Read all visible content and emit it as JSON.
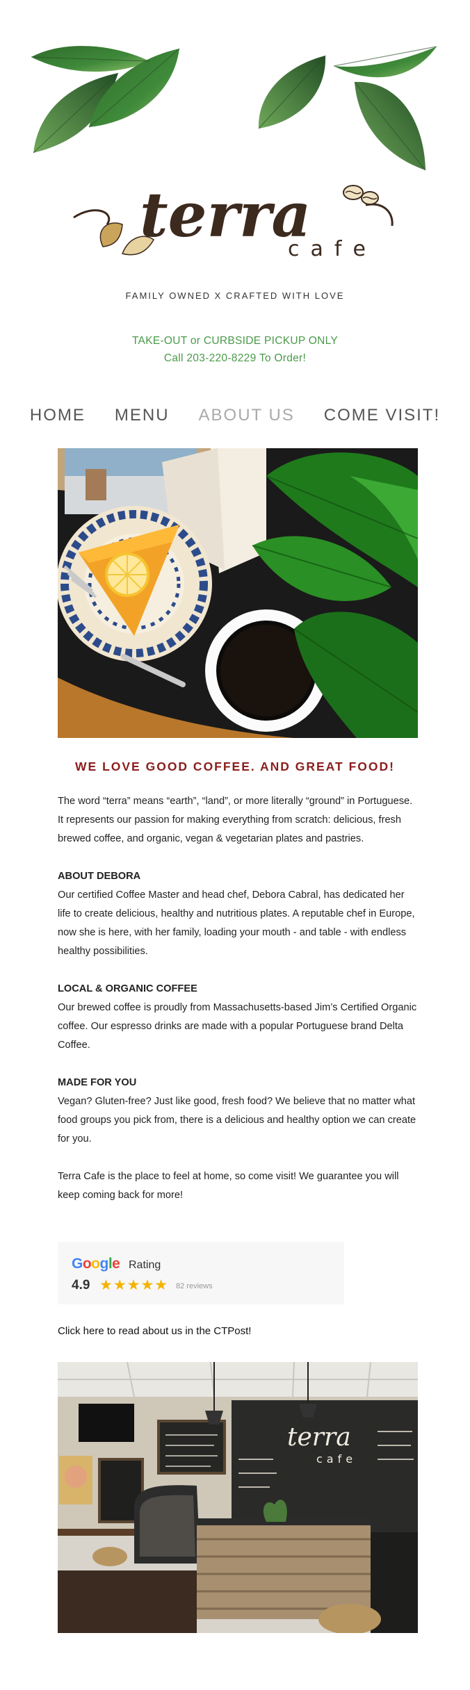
{
  "header": {
    "logo_main": "terra",
    "logo_sub": "cafe",
    "tagline": "FAMILY OWNED X CRAFTED WITH LOVE",
    "notice_line1": "TAKE-OUT or CURBSIDE PICKUP ONLY",
    "notice_line2": "Call 203-220-8229 To Order!"
  },
  "nav": {
    "items": [
      {
        "label": "HOME"
      },
      {
        "label": "MENU"
      },
      {
        "label": "ABOUT US"
      },
      {
        "label": "COME VISIT!"
      }
    ],
    "active_index": 2
  },
  "main": {
    "headline": "WE LOVE GOOD COFFEE. AND GREAT FOOD!",
    "intro": "The word “terra” means “earth”, “land”, or more literally “ground” in Portuguese. It represents our passion for making everything from scratch: delicious, fresh brewed coffee, and organic, vegan & vegetarian plates and pastries.",
    "sections": [
      {
        "title": "ABOUT DEBORA",
        "body": "Our certified Coffee Master and head chef, Debora Cabral, has dedicated her life to create delicious, healthy and nutritious plates. A reputable chef in Europe, now she is here, with her family, loading your mouth - and table - with endless healthy possibilities."
      },
      {
        "title": "LOCAL & ORGANIC COFFEE",
        "body": "Our brewed coffee is proudly from Massachusetts-based Jim’s Certified Organic coffee. Our espresso drinks are made with a popular Portuguese brand Delta Coffee."
      },
      {
        "title": "MADE FOR YOU",
        "body": "Vegan?  Gluten-free?  Just like good, fresh food? We believe that no matter what food groups you pick from, there is a delicious and healthy option we can create for you."
      }
    ],
    "closing": "Terra Cafe is the place to feel at home, so come visit! We guarantee you will keep coming back for more!",
    "rating": {
      "brand": "Google",
      "label": "Rating",
      "score": "4.9",
      "stars": "★★★★★",
      "reviews": "82 reviews"
    },
    "ctpost_link": "Click here to read about us in the CTPost!"
  },
  "interior_sign": {
    "main": "terra",
    "sub": "cafe"
  },
  "colors": {
    "accent_green": "#4a9a4a",
    "headline_red": "#8b1e1e",
    "logo_brown": "#3d2a1e",
    "star": "#f5b300"
  }
}
